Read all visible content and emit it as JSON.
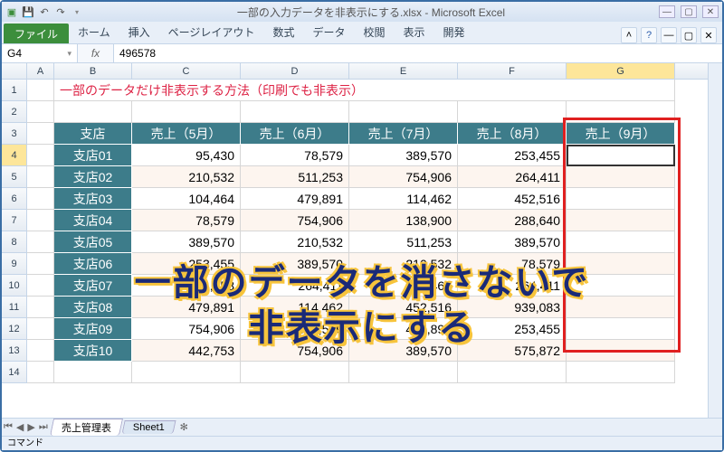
{
  "window": {
    "title": "一部の入力データを非表示にする.xlsx - Microsoft Excel"
  },
  "ribbon": {
    "file": "ファイル",
    "tabs": [
      "ホーム",
      "挿入",
      "ページレイアウト",
      "数式",
      "データ",
      "校閲",
      "表示",
      "開発"
    ]
  },
  "namebox": "G4",
  "formula": "496578",
  "columns": [
    "A",
    "B",
    "C",
    "D",
    "E",
    "F",
    "G"
  ],
  "row_numbers": [
    "1",
    "2",
    "3",
    "4",
    "5",
    "6",
    "7",
    "8",
    "9",
    "10",
    "11",
    "12",
    "13",
    "14"
  ],
  "title_text": "一部のデータだけ非表示する方法（印刷でも非表示）",
  "headers": [
    "支店",
    "売上（5月）",
    "売上（6月）",
    "売上（7月）",
    "売上（8月）",
    "売上（9月）"
  ],
  "rows": [
    {
      "b": "支店01",
      "c": "95,430",
      "d": "78,579",
      "e": "389,570",
      "f": "253,455",
      "g": ""
    },
    {
      "b": "支店02",
      "c": "210,532",
      "d": "511,253",
      "e": "754,906",
      "f": "264,411",
      "g": ""
    },
    {
      "b": "支店03",
      "c": "104,464",
      "d": "479,891",
      "e": "114,462",
      "f": "452,516",
      "g": ""
    },
    {
      "b": "支店04",
      "c": "78,579",
      "d": "754,906",
      "e": "138,900",
      "f": "288,640",
      "g": ""
    },
    {
      "b": "支店05",
      "c": "389,570",
      "d": "210,532",
      "e": "511,253",
      "f": "389,570",
      "g": ""
    },
    {
      "b": "支店06",
      "c": "253,455",
      "d": "389,570",
      "e": "210,532",
      "f": "78,579",
      "g": ""
    },
    {
      "b": "支店07",
      "c": "511,253",
      "d": "264,411",
      "e": "104,464",
      "f": "264,411",
      "g": ""
    },
    {
      "b": "支店08",
      "c": "479,891",
      "d": "114,462",
      "e": "452,516",
      "f": "939,083",
      "g": ""
    },
    {
      "b": "支店09",
      "c": "754,906",
      "d": "452,516",
      "e": "479,891",
      "f": "253,455",
      "g": ""
    },
    {
      "b": "支店10",
      "c": "442,753",
      "d": "754,906",
      "e": "389,570",
      "f": "575,872",
      "g": ""
    }
  ],
  "overlay": {
    "line1": "一部のデータを消さないで",
    "line2": "非表示にする"
  },
  "sheets": [
    "売上管理表",
    "Sheet1"
  ],
  "status": "コマンド",
  "chart_data": {
    "type": "table",
    "title": "一部のデータだけ非表示する方法（印刷でも非表示）",
    "columns": [
      "支店",
      "売上（5月）",
      "売上（6月）",
      "売上（7月）",
      "売上（8月）",
      "売上（9月）"
    ],
    "rows": [
      [
        "支店01",
        95430,
        78579,
        389570,
        253455,
        null
      ],
      [
        "支店02",
        210532,
        511253,
        754906,
        264411,
        null
      ],
      [
        "支店03",
        104464,
        479891,
        114462,
        452516,
        null
      ],
      [
        "支店04",
        78579,
        754906,
        138900,
        288640,
        null
      ],
      [
        "支店05",
        389570,
        210532,
        511253,
        389570,
        null
      ],
      [
        "支店06",
        253455,
        389570,
        210532,
        78579,
        null
      ],
      [
        "支店07",
        511253,
        264411,
        104464,
        264411,
        null
      ],
      [
        "支店08",
        479891,
        114462,
        452516,
        939083,
        null
      ],
      [
        "支店09",
        754906,
        452516,
        479891,
        253455,
        null
      ],
      [
        "支店10",
        442753,
        754906,
        389570,
        575872,
        null
      ]
    ],
    "note": "売上（9月）column values are hidden (formatted invisible); G4 underlying value shown in formula bar is 496578"
  }
}
